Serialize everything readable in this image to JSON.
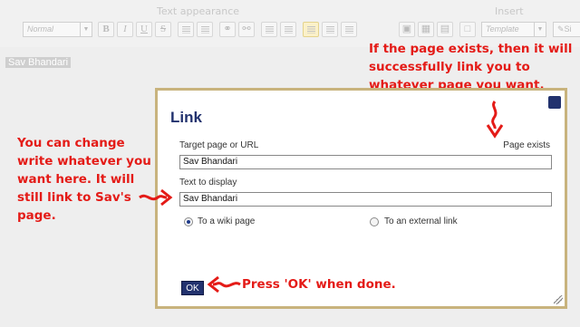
{
  "toolbar": {
    "text_appearance_label": "Text appearance",
    "insert_label": "Insert",
    "format_select": "Normal",
    "template_select": "Template",
    "bold": "B",
    "italic": "I",
    "underline": "U",
    "strike": "S",
    "sig_partial": "Si"
  },
  "editor": {
    "selected_text": "Sav Bhandari"
  },
  "dialog": {
    "title": "Link",
    "target_label": "Target page or URL",
    "page_status": "Page exists",
    "target_value": "Sav Bhandari",
    "display_label": "Text to display",
    "display_value": "Sav Bhandari",
    "radio_wiki": "To a wiki page",
    "radio_external": "To an external link",
    "ok": "OK"
  },
  "annotations": {
    "top_right": [
      "If the page exists, then it will",
      "successfully link you to",
      "whatever page you want."
    ],
    "left": [
      "You can change",
      "write whatever you",
      "want here. It will",
      "still link to Sav's",
      "page."
    ],
    "bottom": "Press 'OK' when done.",
    "color": "#e41b17"
  }
}
